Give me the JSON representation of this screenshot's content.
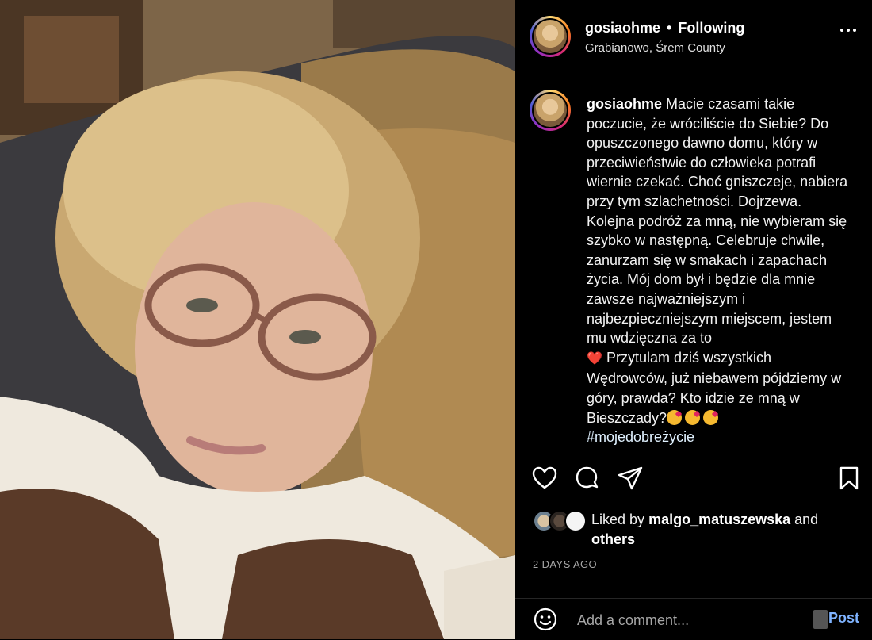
{
  "header": {
    "username": "gosiaohme",
    "separator": "•",
    "follow_status": "Following",
    "location": "Grabianowo, Śrem County"
  },
  "caption": {
    "username": "gosiaohme",
    "text": "Macie czasami takie poczucie, że wróciliście do Siebie? Do opuszczonego dawno domu, który w przeciwieństwie do człowieka potrafi wiernie czekać. Choć gniszczeje, nabiera przy tym szlachetności. Dojrzewa. Kolejna podróż za mną, nie wybieram się szybko w następną. Celebruje chwile, zanurzam się w smakach i zapachach życia. Mój dom był i będzie dla mnie zawsze najważniejszym i najbezpieczniejszym miejscem, jestem mu wdzięczna za to",
    "heart_emoji": "❤️",
    "text_after": "Przytulam dziś wszystkich Wędrowców, już niebawem pójdziemy w góry, prawda? Kto idzie ze mną w Bieszczady?",
    "hashtag": "#mojedobreżycie"
  },
  "likes": {
    "prefix": "Liked by",
    "user": "malgo_matuszewska",
    "suffix": "and",
    "others": "others"
  },
  "date": "2 DAYS AGO",
  "comment": {
    "placeholder": "Add a comment...",
    "post_label": "Post"
  },
  "colors": {
    "link_blue": "#7fb3ff",
    "heart_red": "#e0245e",
    "secondary_text": "#a8a8a8"
  },
  "icons": [
    "like-icon",
    "comment-icon",
    "share-icon",
    "save-icon",
    "emoji-icon",
    "more-options-icon"
  ]
}
